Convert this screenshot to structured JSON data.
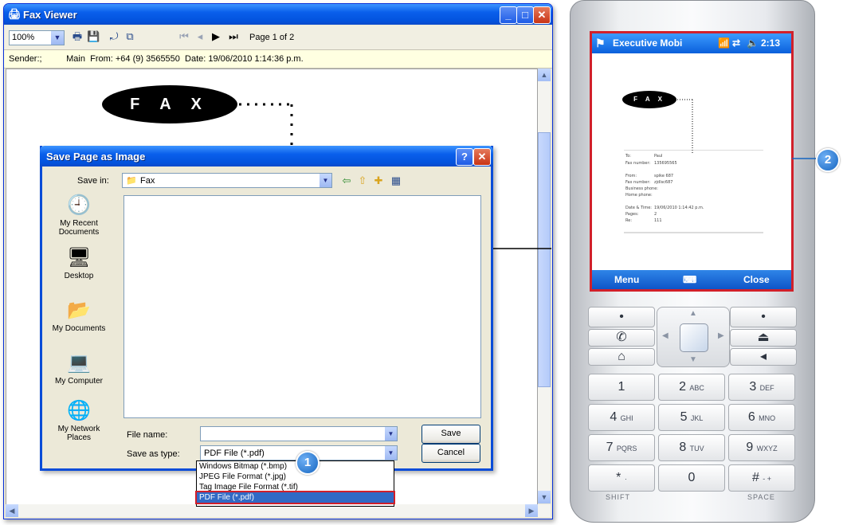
{
  "fax_viewer": {
    "title": "Fax Viewer",
    "zoom": "100%",
    "page_indicator": "Page 1 of 2",
    "sender_bar": "Sender:;          Main  From: +64 (9) 3565550  Date: 19/06/2010 1:14:36 p.m.",
    "fax_banner": "F A X"
  },
  "save_dialog": {
    "title": "Save Page as Image",
    "save_in_label": "Save in:",
    "save_in_value": "Fax",
    "places": [
      "My Recent Documents",
      "Desktop",
      "My Documents",
      "My Computer",
      "My Network Places"
    ],
    "file_name_label": "File name:",
    "file_name_value": "",
    "save_as_type_label": "Save as type:",
    "save_as_type_value": "PDF File (*.pdf)",
    "save_button": "Save",
    "cancel_button": "Cancel",
    "type_options": [
      "Windows Bitmap (*.bmp)",
      "JPEG File Format (*.jpg)",
      "Tag Image File Format (*.tif)",
      "PDF File (*.pdf)"
    ]
  },
  "callouts": {
    "one": "1",
    "two": "2"
  },
  "phone": {
    "title": "Executive Mobi",
    "time": "2:13",
    "fax_banner": "F A X",
    "softkey_left": "Menu",
    "softkey_right": "Close",
    "fields": [
      {
        "label": "To:",
        "value": "Paul"
      },
      {
        "label": "Fax number:",
        "value": "135695565"
      },
      {
        "label": "From:",
        "value": "spike 687"
      },
      {
        "label": "Fax number:",
        "value": "zjdlsc687"
      },
      {
        "label": "Business phone:",
        "value": ""
      },
      {
        "label": "Home phone:",
        "value": ""
      },
      {
        "label": "Date & Time:",
        "value": "19/06/2010 1:14:42 p.m."
      },
      {
        "label": "Pages:",
        "value": "2"
      },
      {
        "label": "Re:",
        "value": "111"
      }
    ],
    "keys": [
      {
        "num": "1",
        "letters": ""
      },
      {
        "num": "2",
        "letters": "ABC"
      },
      {
        "num": "3",
        "letters": "DEF"
      },
      {
        "num": "4",
        "letters": "GHI"
      },
      {
        "num": "5",
        "letters": "JKL"
      },
      {
        "num": "6",
        "letters": "MNO"
      },
      {
        "num": "7",
        "letters": "PQRS"
      },
      {
        "num": "8",
        "letters": "TUV"
      },
      {
        "num": "9",
        "letters": "WXYZ"
      },
      {
        "num": "*",
        "letters": "·"
      },
      {
        "num": "0",
        "letters": ""
      },
      {
        "num": "#",
        "letters": "- +"
      }
    ],
    "shift_label": "SHIFT",
    "space_label": "SPACE"
  },
  "colors": {
    "xp_blue": "#0A5FEB",
    "highlight_red": "#D11F2A",
    "callout_blue": "#1565C0"
  }
}
